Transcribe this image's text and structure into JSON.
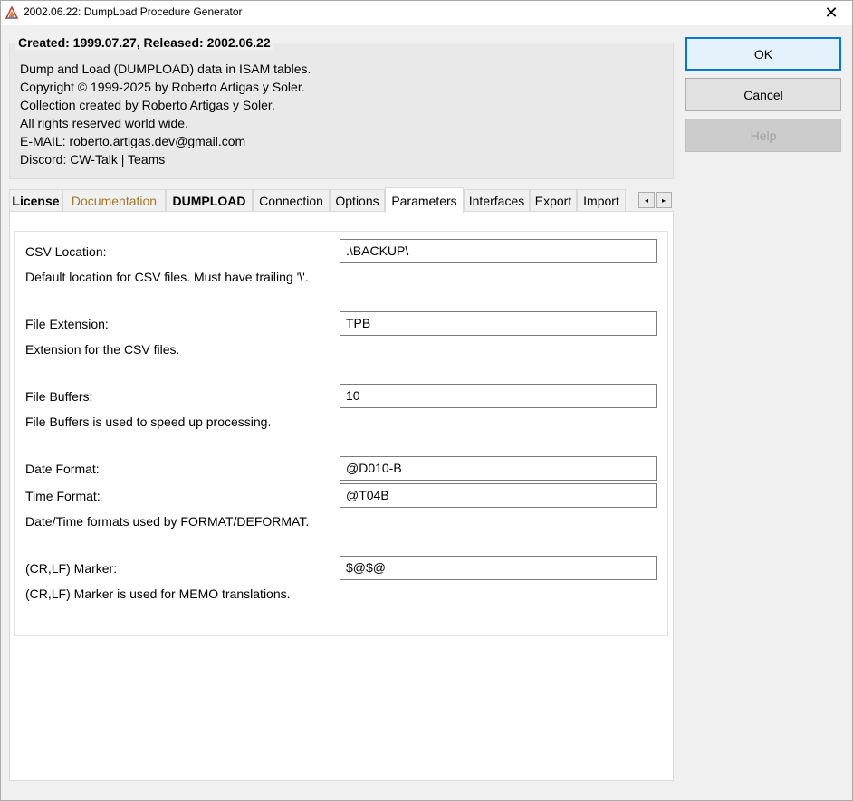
{
  "window": {
    "title": "2002.06.22: DumpLoad Procedure Generator",
    "close_glyph": "✕"
  },
  "header": {
    "caption": "Created: 1999.07.27, Released: 2002.06.22",
    "lines": [
      "Dump and Load (DUMPLOAD) data in ISAM tables.",
      "Copyright © 1999-2025 by Roberto Artigas y Soler.",
      "Collection created by Roberto Artigas y Soler.",
      "All rights reserved world wide.",
      "E-MAIL: roberto.artigas.dev@gmail.com",
      "Discord: CW-Talk | Teams"
    ]
  },
  "buttons": {
    "ok": "OK",
    "cancel": "Cancel",
    "help": "Help"
  },
  "tabs": [
    {
      "label": "License"
    },
    {
      "label": "Documentation"
    },
    {
      "label": "DUMPLOAD"
    },
    {
      "label": "Connection"
    },
    {
      "label": "Options"
    },
    {
      "label": "Parameters"
    },
    {
      "label": "Interfaces"
    },
    {
      "label": "Export"
    },
    {
      "label": "Import"
    }
  ],
  "tab_scroll": {
    "left": "◂",
    "right": "▸"
  },
  "params": {
    "csv_location": {
      "label": "CSV Location:",
      "value": ".\\BACKUP\\",
      "help": "Default location for CSV files. Must have trailing '\\'."
    },
    "file_extension": {
      "label": "File Extension:",
      "value": "TPB",
      "help": "Extension for the CSV files."
    },
    "file_buffers": {
      "label": "File Buffers:",
      "value": "10",
      "help": "File Buffers is used to speed up processing."
    },
    "date_format": {
      "label": "Date Format:",
      "value": "@D010-B"
    },
    "time_format": {
      "label": "Time Format:",
      "value": "@T04B",
      "help": "Date/Time formats used by FORMAT/DEFORMAT."
    },
    "crlf_marker": {
      "label": "(CR,LF) Marker:",
      "value": "$@$@",
      "help": "(CR,LF) Marker is used for MEMO translations."
    }
  },
  "colors": {
    "accent": "#0078d7",
    "documentation_tab": "#a0782a"
  }
}
